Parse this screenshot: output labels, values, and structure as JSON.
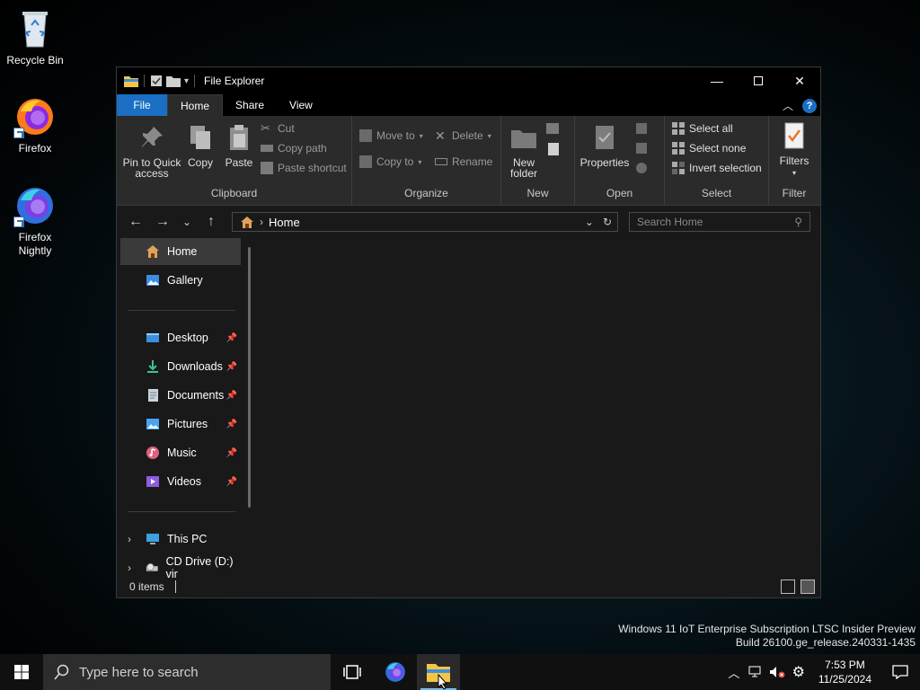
{
  "desktop": {
    "icons": [
      {
        "label": "Recycle Bin"
      },
      {
        "label": "Firefox"
      },
      {
        "label": "Firefox Nightly"
      }
    ],
    "watermark_line1": "Windows 11 IoT Enterprise Subscription LTSC Insider Preview",
    "watermark_line2": "Build 26100.ge_release.240331-1435"
  },
  "window": {
    "title": "File Explorer",
    "tabs": [
      "File",
      "Home",
      "Share",
      "View"
    ],
    "active_tab": "Home",
    "ribbon": {
      "clipboard": {
        "label": "Clipboard",
        "pin_line1": "Pin to Quick",
        "pin_line2": "access",
        "copy": "Copy",
        "paste": "Paste",
        "cut": "Cut",
        "copy_path": "Copy path",
        "paste_shortcut": "Paste shortcut"
      },
      "organize": {
        "label": "Organize",
        "move_to": "Move to",
        "copy_to": "Copy to",
        "delete": "Delete",
        "rename": "Rename"
      },
      "new": {
        "label": "New",
        "new_folder_line1": "New",
        "new_folder_line2": "folder"
      },
      "open": {
        "label": "Open",
        "properties": "Properties"
      },
      "select": {
        "label": "Select",
        "select_all": "Select all",
        "select_none": "Select none",
        "invert_selection": "Invert selection"
      },
      "filter": {
        "label": "Filter",
        "filters": "Filters"
      }
    },
    "address": {
      "path": "Home",
      "search_placeholder": "Search Home"
    },
    "nav": {
      "home": "Home",
      "gallery": "Gallery",
      "desktop": "Desktop",
      "downloads": "Downloads",
      "documents": "Documents",
      "pictures": "Pictures",
      "music": "Music",
      "videos": "Videos",
      "this_pc": "This PC",
      "cd_drive": "CD Drive (D:) vir"
    },
    "status": {
      "items": "0 items"
    }
  },
  "taskbar": {
    "search_placeholder": "Type here to search",
    "time": "7:53 PM",
    "date": "11/25/2024"
  },
  "colors": {
    "accent": "#1a6fc4",
    "folder": "#f4c542"
  }
}
